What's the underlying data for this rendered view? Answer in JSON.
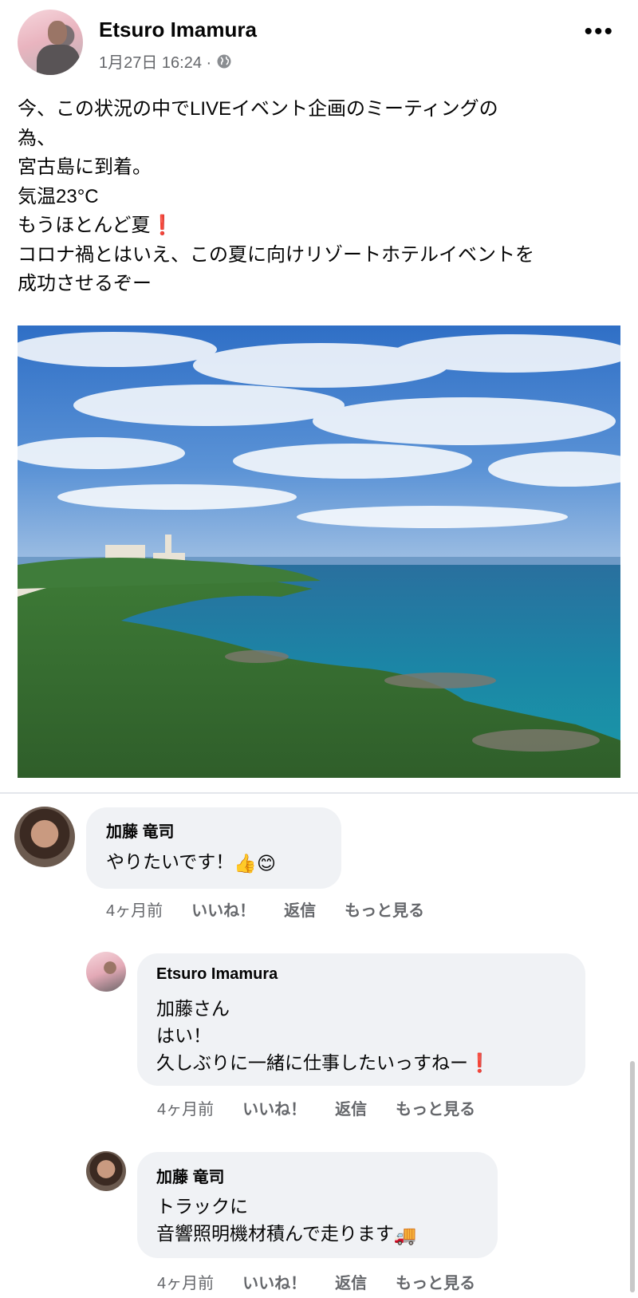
{
  "post": {
    "author": "Etsuro Imamura",
    "timestamp": "1月27日 16:24 ·",
    "privacy_icon": "globe-icon",
    "more_label": "•••",
    "lines": [
      "今、この状況の中でLIVEイベント企画のミーティングの",
      "為、",
      "宮古島に到着。",
      "気温23°C",
      "もうほとんど夏",
      "コロナ禍とはいえ、この夏に向けリゾートホテルイベントを",
      "成功させるぞー"
    ],
    "exclamation": "❗"
  },
  "comments": [
    {
      "name": "加藤 竜司",
      "text": "やりたいです！",
      "emoji_thumb": "👍",
      "emoji_smile": "😊",
      "time": "4ヶ月前",
      "like": "いいね！",
      "reply": "返信",
      "more": "もっと見る"
    },
    {
      "name": "Etsuro Imamura",
      "line1": "加藤さん",
      "line2": "はい！",
      "line3": "久しぶりに一緒に仕事したいっすねー",
      "exclamation": "❗",
      "time": "4ヶ月前",
      "like": "いいね！",
      "reply": "返信",
      "more": "もっと見る"
    },
    {
      "name": "加藤 竜司",
      "line1": "トラックに",
      "line2": "音響照明機材積んで走ります",
      "emoji_truck": "🚚",
      "time": "4ヶ月前",
      "like": "いいね！",
      "reply": "返信",
      "more": "もっと見る"
    }
  ],
  "colors": {
    "secondary_text": "#65676b",
    "bubble": "#f0f2f5",
    "sky": "#3f7fd0",
    "sea": "#1f7fa8"
  }
}
